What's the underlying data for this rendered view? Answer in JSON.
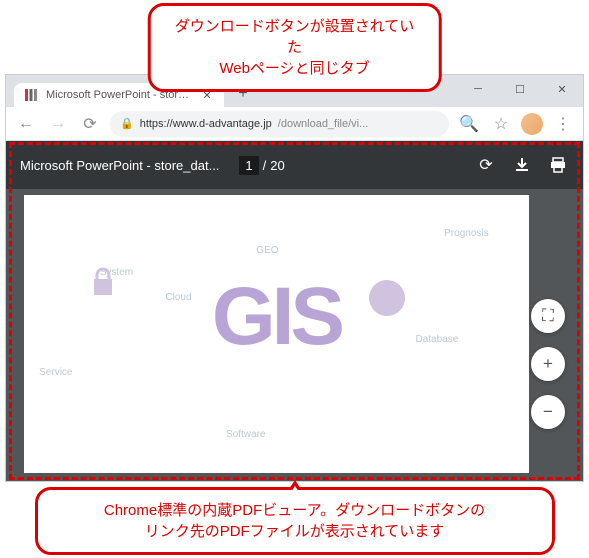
{
  "callouts": {
    "top": "ダウンロードボタンが設置されていた\nWebページと同じタブ",
    "bottom": "Chrome標準の内蔵PDFビューア。ダウンロードボタンの\nリンク先のPDFファイルが表示されています"
  },
  "browser": {
    "tab_title": "Microsoft PowerPoint - store_dat...",
    "url": {
      "host": "https://www.d-advantage.jp",
      "path": "/download_file/vi..."
    }
  },
  "pdf": {
    "title": "Microsoft PowerPoint - store_dat...",
    "page": "1",
    "sep": "/",
    "total": "20"
  },
  "doc_labels": {
    "geo": "GEO",
    "prognosis": "Prognosis",
    "system": "System",
    "cloud": "Cloud",
    "database": "Database",
    "service": "Service",
    "software": "Software",
    "gis": "GIS"
  },
  "fab": {
    "fit": "⛶",
    "plus": "+",
    "minus": "−"
  },
  "icons": {
    "reload": "⟳",
    "download": "⬇",
    "print": "🖶",
    "back": "←",
    "forward": "→",
    "refresh": "⟳",
    "search": "🔍",
    "star": "☆",
    "menu": "⋮",
    "close": "✕",
    "newtab": "+",
    "lock": "🔒"
  }
}
